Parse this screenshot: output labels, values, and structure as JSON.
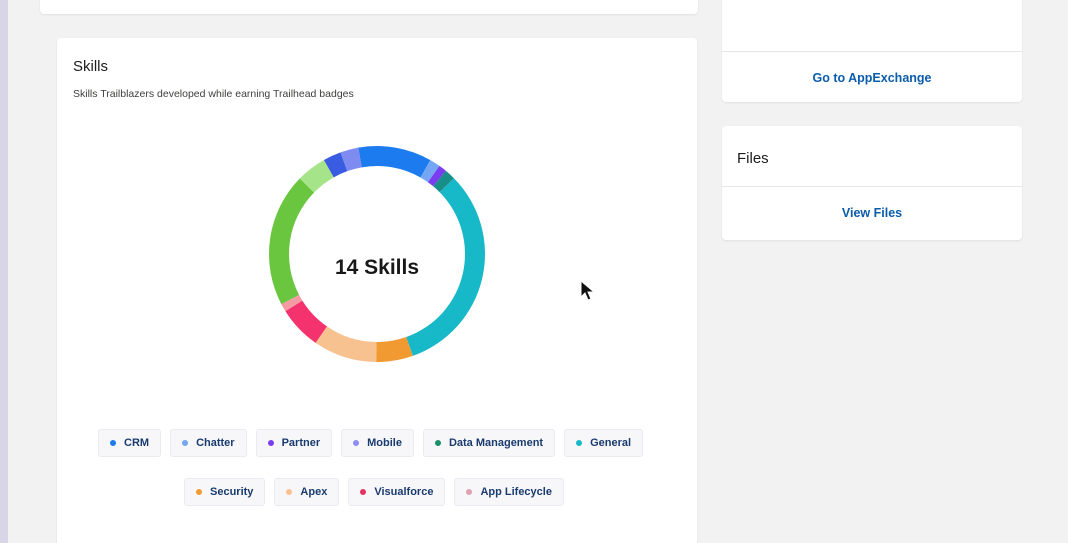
{
  "skills": {
    "title": "Skills",
    "subtitle": "Skills Trailblazers developed while earning Trailhead badges",
    "center_label": "14 Skills"
  },
  "chart_data": {
    "type": "pie",
    "segments": [
      {
        "color": "#1b7bef",
        "value": 11.0
      },
      {
        "color": "#74a6f4",
        "value": 1.6
      },
      {
        "color": "#7a3df0",
        "value": 1.2
      },
      {
        "color": "#1a8f8a",
        "value": 1.6
      },
      {
        "color": "#17b8c8",
        "value": 32.0
      },
      {
        "color": "#f19a32",
        "value": 5.5
      },
      {
        "color": "#f7c28f",
        "value": 9.5
      },
      {
        "color": "#f4336e",
        "value": 6.5
      },
      {
        "color": "#f49aa2",
        "value": 1.2
      },
      {
        "color": "#6ac53f",
        "value": 20.0
      },
      {
        "color": "#a6e48a",
        "value": 4.5
      },
      {
        "color": "#3a5ce0",
        "value": 2.7
      },
      {
        "color": "#7e8bf0",
        "value": 2.7
      }
    ],
    "legend": [
      {
        "label": "CRM",
        "color": "#1b7bef"
      },
      {
        "label": "Chatter",
        "color": "#74a6f4"
      },
      {
        "label": "Partner",
        "color": "#7a3df0"
      },
      {
        "label": "Mobile",
        "color": "#8d8df2"
      },
      {
        "label": "Data Management",
        "color": "#1a8f6a"
      },
      {
        "label": "General",
        "color": "#17b8c8"
      },
      {
        "label": "Security",
        "color": "#f19a32"
      },
      {
        "label": "Apex",
        "color": "#f7c28f"
      },
      {
        "label": "Visualforce",
        "color": "#e3335e"
      },
      {
        "label": "App Lifecycle",
        "color": "#e0a0b4"
      }
    ]
  },
  "sidebar": {
    "appexchange_label": "Go to AppExchange",
    "files_title": "Files",
    "view_files_label": "View Files"
  }
}
